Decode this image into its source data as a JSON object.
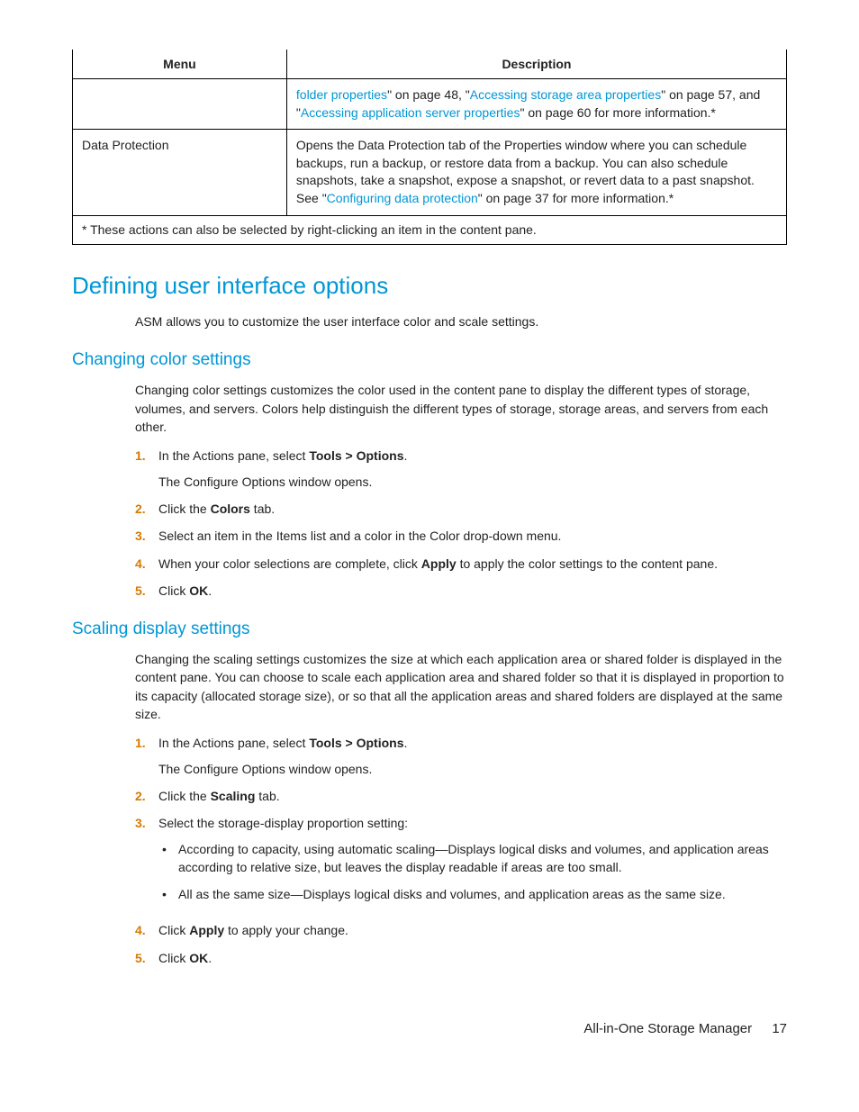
{
  "table": {
    "headers": [
      "Menu",
      "Description"
    ],
    "row0_desc_link1": "folder properties",
    "row0_desc_mid1": "\" on page 48, \"",
    "row0_desc_link2": "Accessing storage area properties",
    "row0_desc_mid2": "\" on page 57, and \"",
    "row0_desc_link3": "Accessing application server properties",
    "row0_desc_end": "\" on page 60 for more information.*",
    "row1_menu": "Data Protection",
    "row1_desc_pre": "Opens the Data Protection tab of the Properties window where you can schedule backups, run a backup, or restore data from a backup. You can also schedule snapshots, take a snapshot, expose a snapshot, or revert data to a past snapshot. See \"",
    "row1_desc_link": "Configuring data protection",
    "row1_desc_end": "\" on page 37 for more information.*",
    "footnote": "* These actions can also be selected by right-clicking an item in the content pane."
  },
  "h1": "Defining user interface options",
  "p1": "ASM allows you to customize the user interface color and scale settings.",
  "h2a": "Changing color settings",
  "p2": "Changing color settings customizes the color used in the content pane to display the different types of storage, volumes, and servers. Colors help distinguish the different types of storage, storage areas, and servers from each other.",
  "stepsA": {
    "s1_pre": "In the Actions pane, select ",
    "s1_bold": "Tools > Options",
    "s1_post": ".",
    "s1_sub": "The Configure Options window opens.",
    "s2_pre": "Click the ",
    "s2_bold": "Colors",
    "s2_post": " tab.",
    "s3": "Select an item in the Items list and a color in the Color drop-down menu.",
    "s4_pre": "When your color selections are complete, click ",
    "s4_bold": "Apply",
    "s4_post": " to apply the color settings to the content pane.",
    "s5_pre": "Click ",
    "s5_bold": "OK",
    "s5_post": "."
  },
  "h2b": "Scaling display settings",
  "p3": "Changing the scaling settings customizes the size at which each application area or shared folder is displayed in the content pane. You can choose to scale each application area and shared folder so that it is displayed in proportion to its capacity (allocated storage size), or so that all the application areas and shared folders are displayed at the same size.",
  "stepsB": {
    "s1_pre": "In the Actions pane, select ",
    "s1_bold": "Tools > Options",
    "s1_post": ".",
    "s1_sub": "The Configure Options window opens.",
    "s2_pre": "Click the ",
    "s2_bold": "Scaling",
    "s2_post": " tab.",
    "s3": "Select the storage-display proportion setting:",
    "b1": "According to capacity, using automatic scaling—Displays logical disks and volumes, and application areas according to relative size, but leaves the display readable if areas are too small.",
    "b2": "All as the same size—Displays logical disks and volumes, and application areas as the same size.",
    "s4_pre": "Click ",
    "s4_bold": "Apply",
    "s4_post": " to apply your change.",
    "s5_pre": "Click ",
    "s5_bold": "OK",
    "s5_post": "."
  },
  "footer": {
    "title": "All-in-One Storage Manager",
    "page": "17"
  },
  "nums": {
    "n1": "1.",
    "n2": "2.",
    "n3": "3.",
    "n4": "4.",
    "n5": "5."
  },
  "bullet": "•"
}
